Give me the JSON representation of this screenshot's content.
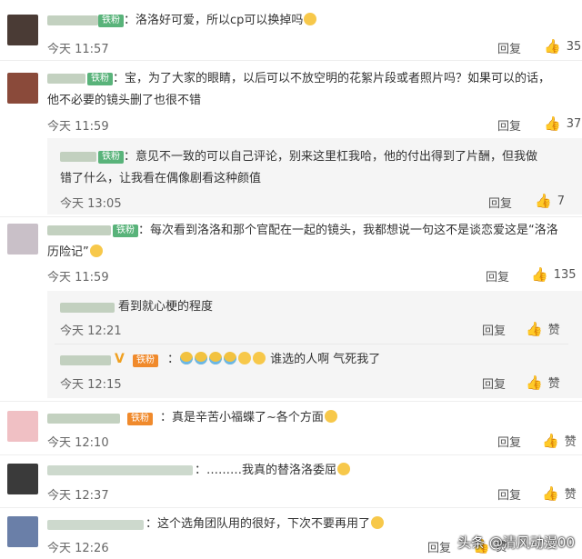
{
  "comments": [
    {
      "badge": "铁粉",
      "text": "：洛洛好可爱，所以cp可以换掉吗",
      "time": "今天 11:57",
      "reply": "回复",
      "likes": "35"
    },
    {
      "badge": "铁粉",
      "text_line1": "：宝，为了大家的眼睛，以后可以不放空明的花絮片段或者照片吗？如果可以的话，",
      "text_line2": "他不必要的镜头删了也很不错",
      "time": "今天 11:59",
      "reply": "回复",
      "likes": "37",
      "sub": [
        {
          "badge": "铁粉",
          "text_line1": "：意见不一致的可以自己评论，别来这里杠我哈，他的付出得到了片酬，但我做",
          "text_line2": "错了什么，让我看在偶像剧看这种颜值",
          "time": "今天 13:05",
          "reply": "回复",
          "likes": "7"
        }
      ]
    },
    {
      "badge": "铁粉",
      "text_line1": "：每次看到洛洛和那个官配在一起的镜头，我都想说一句这不是谈恋爱这是“洛洛",
      "text_line2": "历险记”",
      "time": "今天 11:59",
      "reply": "回复",
      "likes": "135",
      "sub": [
        {
          "text": "看到就心梗的程度",
          "time": "今天 12:21",
          "reply": "回复",
          "likes": "赞"
        },
        {
          "badge": "铁粉",
          "text": "谁选的人啊 气死我了",
          "time": "今天 12:15",
          "reply": "回复",
          "likes": "赞"
        }
      ]
    },
    {
      "badge": "铁粉",
      "text": "：真是辛苦小福蝶了~各个方面",
      "time": "今天 12:10",
      "reply": "回复",
      "likes": "赞"
    },
    {
      "text": "：………我真的替洛洛委屈",
      "time": "今天 12:37",
      "reply": "回复",
      "likes": "赞"
    },
    {
      "text": "：这个选角团队用的很好，下次不要再用了",
      "time": "今天 12:26",
      "reply": "回复",
      "likes": "赞"
    }
  ],
  "watermark": "头条 @清风动漫00",
  "colors": {
    "badge_green": "#59b37a",
    "badge_orange": "#f08a2c",
    "like_active": "#ee6f3c"
  }
}
